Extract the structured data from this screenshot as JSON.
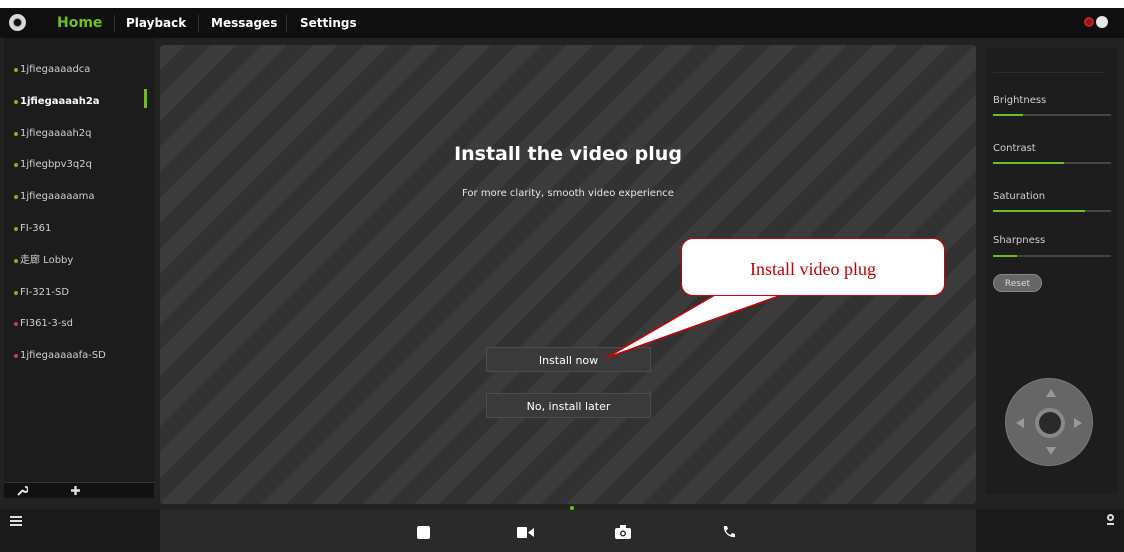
{
  "nav": {
    "home": "Home",
    "playback": "Playback",
    "messages": "Messages",
    "settings": "Settings"
  },
  "devices": [
    {
      "label": "1jfiegaaaadca",
      "status": "online",
      "active": false
    },
    {
      "label": "1jfiegaaaah2a",
      "status": "online",
      "active": true
    },
    {
      "label": "1jfiegaaaah2q",
      "status": "online",
      "active": false
    },
    {
      "label": "1jfiegbpv3q2q",
      "status": "online",
      "active": false
    },
    {
      "label": "1jfiegaaaaama",
      "status": "online",
      "active": false
    },
    {
      "label": "FI-361",
      "status": "online",
      "active": false
    },
    {
      "label": "走廊 Lobby",
      "status": "online",
      "active": false
    },
    {
      "label": "FI-321-SD",
      "status": "online",
      "active": false
    },
    {
      "label": "FI361-3-sd",
      "status": "offline",
      "active": false
    },
    {
      "label": "1jfiegaaaaafa-SD",
      "status": "offline",
      "active": false
    }
  ],
  "video": {
    "title": "Install the video plug",
    "subtitle": "For more clarity, smooth video experience",
    "install_button": "Install now",
    "later_button": "No, install later"
  },
  "callout": {
    "text": "Install video plug"
  },
  "adjustments": {
    "brightness": {
      "label": "Brightness",
      "level": 0.25
    },
    "contrast": {
      "label": "Contrast",
      "level": 0.6
    },
    "saturation": {
      "label": "Saturation",
      "level": 0.78
    },
    "sharpness": {
      "label": "Sharpness",
      "level": 0.2
    },
    "reset_label": "Reset"
  },
  "colors": {
    "accent": "#6fbe1f",
    "offline": "#d23a3a",
    "callout": "#c00000"
  },
  "icons": {
    "tools": [
      "wrench-icon",
      "plus-icon"
    ],
    "bottom": [
      "stop-icon",
      "record-icon",
      "snapshot-icon",
      "talk-icon"
    ]
  }
}
